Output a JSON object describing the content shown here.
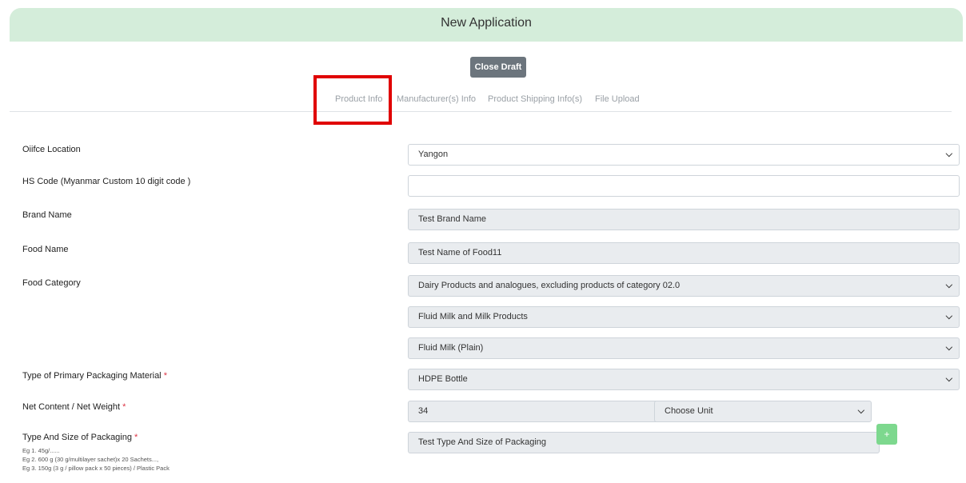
{
  "header": {
    "title": "New Application"
  },
  "close_draft_label": "Close Draft",
  "tabs": [
    {
      "label": "Product Info"
    },
    {
      "label": "Manufacturer(s) Info"
    },
    {
      "label": "Product Shipping Info(s)"
    },
    {
      "label": "File Upload"
    }
  ],
  "form": {
    "office_location": {
      "label": "Oiifce Location",
      "value": "Yangon"
    },
    "hs_code": {
      "label": "HS Code (Myanmar Custom 10 digit code )",
      "value": ""
    },
    "brand_name": {
      "label": "Brand Name",
      "value": "Test Brand Name"
    },
    "food_name": {
      "label": "Food Name",
      "value": "Test Name of Food11"
    },
    "food_category": {
      "label": "Food Category",
      "level1": "Dairy Products and analogues, excluding products of category 02.0",
      "level2": "Fluid Milk and Milk Products",
      "level3": "Fluid Milk (Plain)"
    },
    "packaging_material": {
      "label": "Type of Primary Packaging Material",
      "required": "*",
      "value": "HDPE Bottle"
    },
    "net_content": {
      "label": "Net Content / Net Weight",
      "required": "*",
      "value": "34",
      "unit": "Choose Unit"
    },
    "packaging_type_size": {
      "label": "Type And Size of Packaging",
      "required": "*",
      "value": "Test Type And Size of Packaging",
      "hints": [
        "Eg 1. 45g/......",
        "Eg 2. 600 g (30 g/multilayer sachet)x 20 Sachets...,",
        "Eg 3. 150g (3 g / pillow pack x 50 pieces) / Plastic Pack"
      ],
      "add_label": "+"
    }
  }
}
